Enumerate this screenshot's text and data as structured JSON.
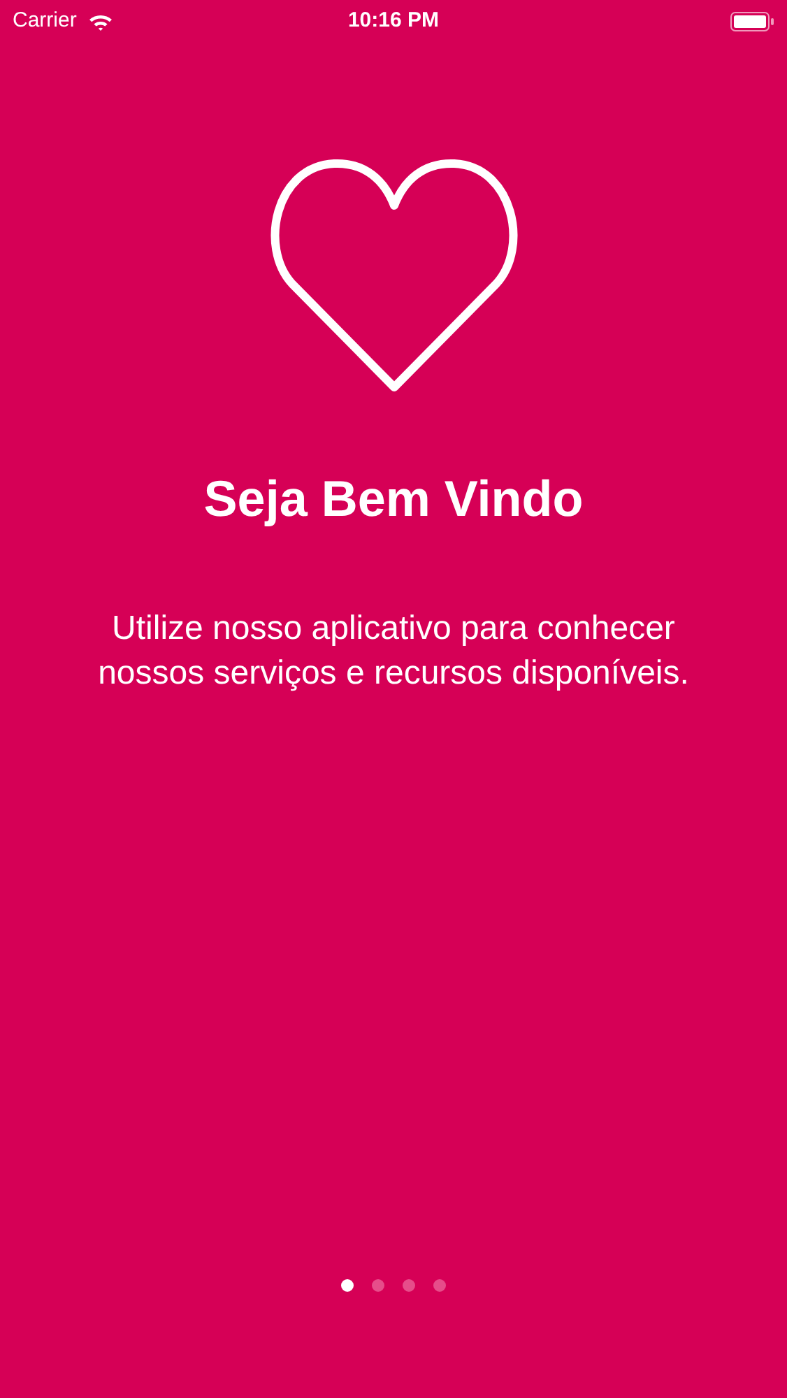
{
  "status_bar": {
    "carrier": "Carrier",
    "time": "10:16 PM"
  },
  "title": "Seja Bem Vindo",
  "description": "Utilize nosso aplicativo para conhecer nossos serviços e recursos disponíveis.",
  "pages": [
    {
      "selected": true
    },
    {
      "selected": false
    },
    {
      "selected": false
    },
    {
      "selected": false
    }
  ]
}
